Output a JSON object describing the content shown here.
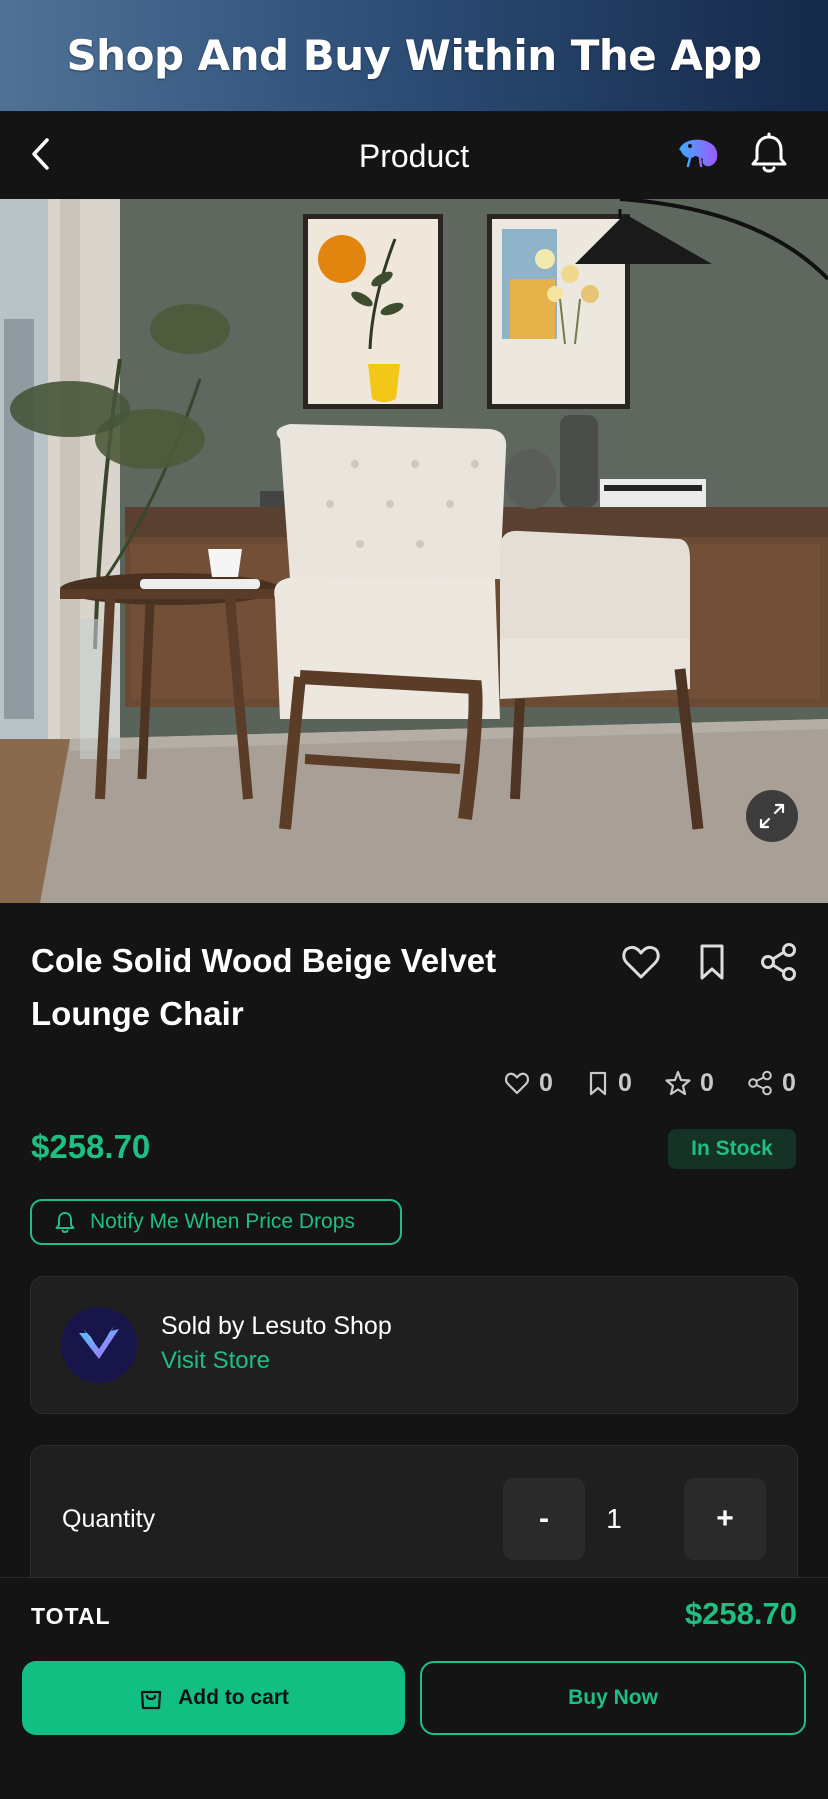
{
  "banner": {
    "text": "Shop And Buy Within The App"
  },
  "nav": {
    "title": "Product",
    "back_icon": "chevron-left-icon",
    "logo_icon": "chameleon-logo-icon",
    "bell_icon": "bell-icon"
  },
  "product": {
    "title": "Cole Solid Wood Beige Velvet Lounge Chair",
    "price": "$258.70",
    "stock_status": "In Stock",
    "stats": {
      "likes": "0",
      "bookmarks": "0",
      "ratings": "0",
      "shares": "0"
    }
  },
  "notify": {
    "label": "Notify Me When Price Drops"
  },
  "seller": {
    "sold_by": "Sold by Lesuto Shop",
    "visit_label": "Visit Store"
  },
  "quantity": {
    "label": "Quantity",
    "value": "1",
    "minus": "-",
    "plus": "+"
  },
  "total": {
    "label": "TOTAL",
    "value": "$258.70"
  },
  "actions": {
    "add_to_cart": "Add to cart",
    "buy_now": "Buy Now"
  },
  "colors": {
    "accent": "#1fbf83",
    "background": "#141414",
    "card": "#1f1f1f"
  }
}
